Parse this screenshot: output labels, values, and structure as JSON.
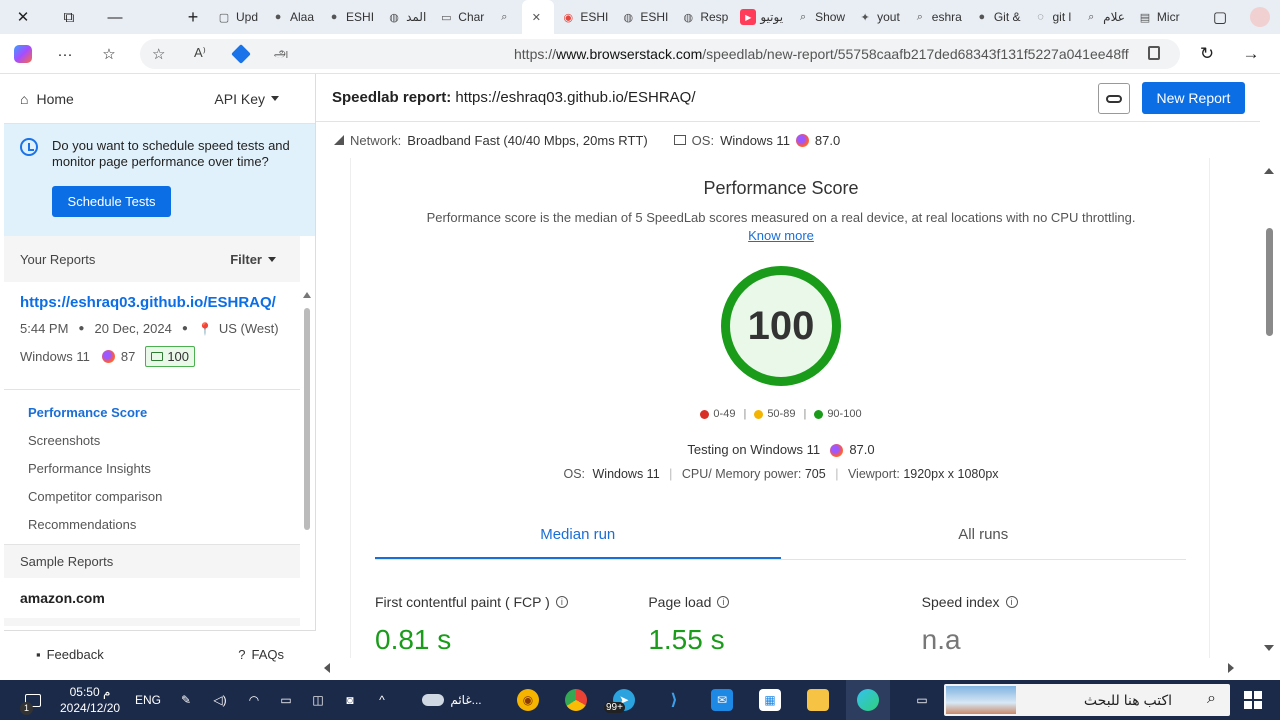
{
  "browser": {
    "tabs": [
      {
        "label": "Upd",
        "icon": "page-icon"
      },
      {
        "label": "Alaa",
        "icon": "github-icon"
      },
      {
        "label": "ESHI",
        "icon": "github-icon"
      },
      {
        "label": "المد",
        "icon": "globe-icon"
      },
      {
        "label": "Char",
        "icon": "folder-icon"
      },
      {
        "label": "",
        "icon": "search-icon"
      },
      {
        "label": "",
        "icon": "close-icon"
      },
      {
        "label": "ESHI",
        "icon": "chrome-icon"
      },
      {
        "label": "ESHI",
        "icon": "globe-icon"
      },
      {
        "label": "Resp",
        "icon": "globe-icon"
      },
      {
        "label": "يوتيو",
        "icon": "youtube-icon"
      },
      {
        "label": "Show",
        "icon": "search-icon"
      },
      {
        "label": "yout",
        "icon": "cat-icon"
      },
      {
        "label": "eshra",
        "icon": "search-icon"
      },
      {
        "label": "Git &",
        "icon": "github-icon"
      },
      {
        "label": "git l",
        "icon": "extension-icon"
      },
      {
        "label": "علام",
        "icon": "search-icon"
      },
      {
        "label": "Micr",
        "icon": "window-icon"
      }
    ],
    "url_prefix": "https://",
    "url_domain": "www.browserstack.com",
    "url_path": "/speedlab/new-report/55758caafb217ded68343f131f5227a041ee48ff",
    "read_aloud": "A⁾",
    "translate": "அ"
  },
  "sidebar": {
    "home": "Home",
    "api_key": "API Key",
    "promo_text": "Do you want to schedule speed tests and monitor page performance over time?",
    "schedule_button": "Schedule Tests",
    "your_reports": "Your Reports",
    "filter": "Filter",
    "report": {
      "url": "https://eshraq03.github.io/ESHRAQ/",
      "time": "5:44 PM",
      "date": "20 Dec, 2024",
      "location": "US (West)",
      "os": "Windows 11",
      "browser_version": "87",
      "score": "100"
    },
    "nav": [
      "Performance Score",
      "Screenshots",
      "Performance Insights",
      "Competitor comparison",
      "Recommendations"
    ],
    "sample_reports": "Sample Reports",
    "sample_item": "amazon.com",
    "feedback": "Feedback",
    "faqs": "FAQs"
  },
  "header": {
    "title_label": "Speedlab report:",
    "title_url": "https://eshraq03.github.io/ESHRAQ/",
    "new_report": "New Report"
  },
  "netbar": {
    "network_label": "Network:",
    "network_value": "Broadband Fast (40/40 Mbps, 20ms RTT)",
    "os_label": "OS:",
    "os_value": "Windows 11",
    "browser_version": "87.0"
  },
  "score": {
    "title": "Performance Score",
    "description": "Performance score is the median of 5 SpeedLab scores measured on a real device, at real locations with no CPU throttling.",
    "know_more": "Know more",
    "value": "100",
    "legend": [
      {
        "label": "0-49",
        "color": "#d93025"
      },
      {
        "label": "50-89",
        "color": "#f4b400"
      },
      {
        "label": "90-100",
        "color": "#1a9c1a"
      }
    ],
    "testing_on": "Testing on Windows 11",
    "testing_version": "87.0",
    "os_label": "OS:",
    "os_value": "Windows 11",
    "cpu_label": "CPU/ Memory power:",
    "cpu_value": "705",
    "viewport_label": "Viewport:",
    "viewport_value": "1920px x 1080px"
  },
  "runs": {
    "median": "Median run",
    "all": "All runs"
  },
  "metrics": [
    {
      "label": "First contentful paint ( FCP )",
      "value": "0.81 s"
    },
    {
      "label": "Page load",
      "value": "1.55 s"
    },
    {
      "label": "Speed index",
      "value": "n.a"
    }
  ],
  "taskbar": {
    "time": "05:50 م",
    "date": "2024/12/20",
    "lang": "ENG",
    "weather": "غائم...",
    "badge": "1",
    "telegram_badge": "99+",
    "search_placeholder": "اكتب هنا للبحث"
  },
  "colors": {
    "accent": "#0c6ee5",
    "good": "#1a9c1a",
    "taskbar": "#1c2a4a"
  }
}
